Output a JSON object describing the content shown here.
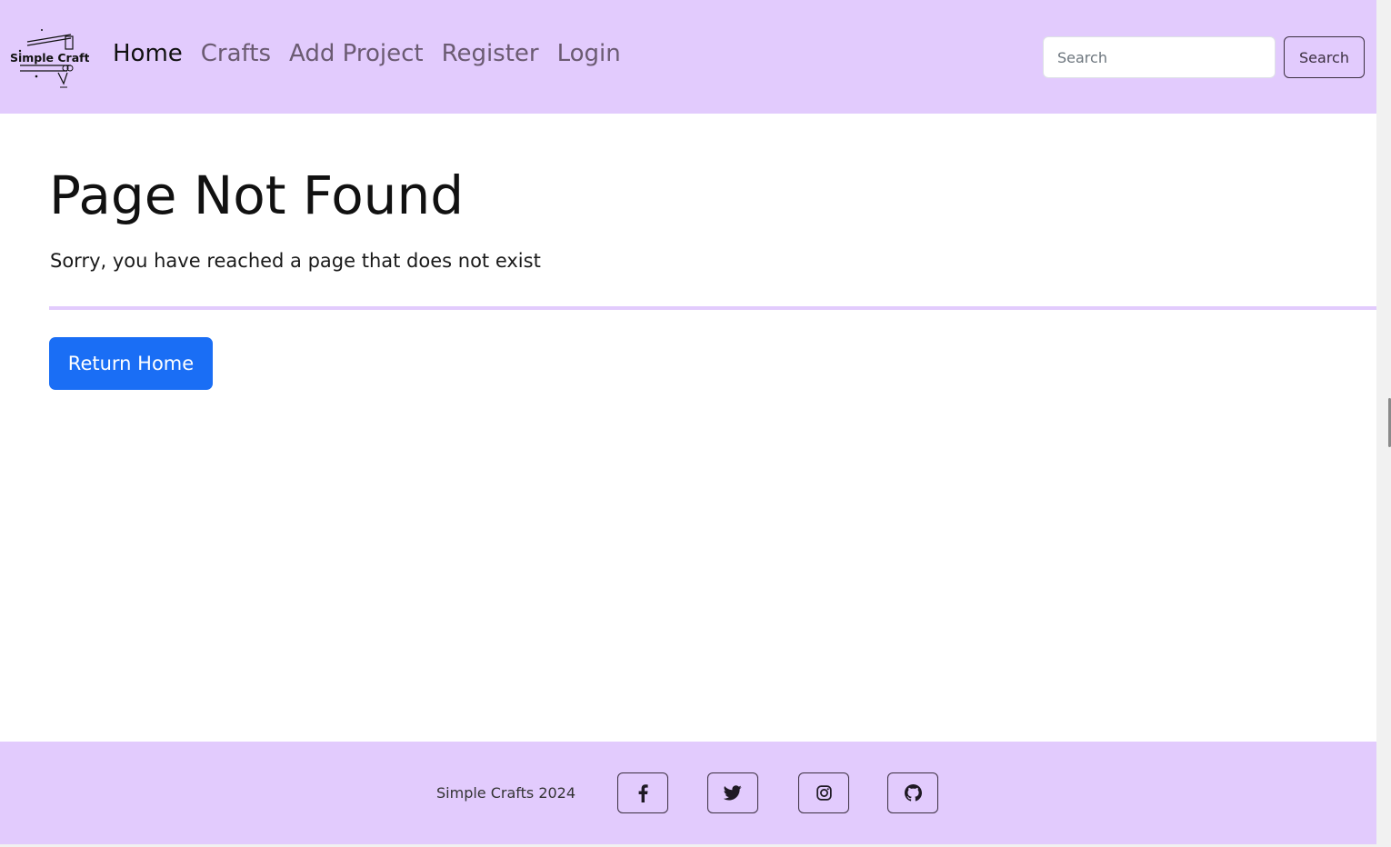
{
  "brand": {
    "logo_text": "Simple Crafts",
    "accent_color": "#e2cbfd"
  },
  "nav": {
    "items": [
      {
        "label": "Home",
        "active": true
      },
      {
        "label": "Crafts",
        "active": false
      },
      {
        "label": "Add Project",
        "active": false
      },
      {
        "label": "Register",
        "active": false
      },
      {
        "label": "Login",
        "active": false
      }
    ]
  },
  "search": {
    "placeholder": "Search",
    "value": "",
    "button_label": "Search"
  },
  "main": {
    "title": "Page Not Found",
    "message": "Sorry, you have reached a page that does not exist",
    "button_label": "Return Home",
    "button_color": "#1a6ef5"
  },
  "footer": {
    "text": "Simple Crafts 2024",
    "social": [
      {
        "icon": "facebook-icon"
      },
      {
        "icon": "twitter-icon"
      },
      {
        "icon": "instagram-icon"
      },
      {
        "icon": "github-icon"
      }
    ]
  }
}
